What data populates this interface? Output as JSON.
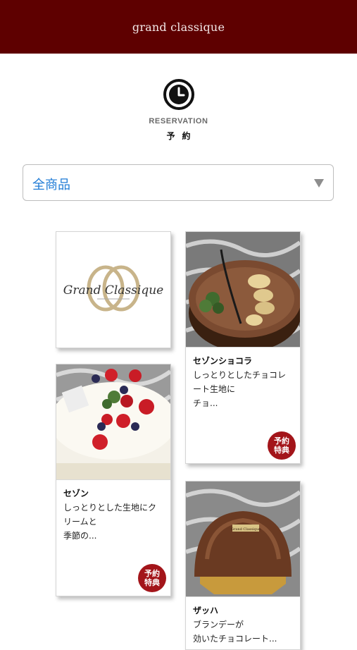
{
  "header": {
    "title": "grand classique"
  },
  "reservation": {
    "label_en": "RESERVATION",
    "label_ja": "予約",
    "icon": "clock-icon"
  },
  "filter": {
    "selected": "全商品"
  },
  "logo": {
    "text": "Grand Classique"
  },
  "products": [
    {
      "name": "セゾンショコラ",
      "desc": [
        "しっとりとしたチョコレ",
        "ート生地に",
        "チョ..."
      ],
      "badge": "予約特典"
    },
    {
      "name": "セゾン",
      "desc": [
        "しっとりとした生地にク",
        "リームと",
        "季節の..."
      ],
      "badge": "予約特典"
    },
    {
      "name": "ザッハ",
      "desc": [
        "ブランデーが",
        "効いたチョコレート..."
      ],
      "plate_text": "Grand Classique"
    }
  ],
  "colors": {
    "header_bg": "#5e0000",
    "accent_blue": "#1f7bd6",
    "badge_red": "#a3151a"
  }
}
